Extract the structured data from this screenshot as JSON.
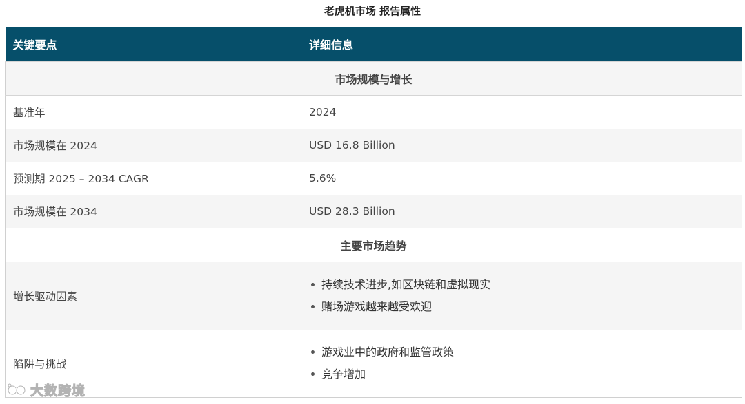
{
  "title": "老虎机市场 报告属性",
  "header": {
    "col1": "关键要点",
    "col2": "详细信息"
  },
  "sections": [
    {
      "heading": "市场规模与增长",
      "rows": [
        {
          "key": "基准年",
          "value": "2024"
        },
        {
          "key": "市场规模在 2024",
          "value": "USD 16.8 Billion"
        },
        {
          "key": "预测期 2025 – 2034 CAGR",
          "value": "5.6%"
        },
        {
          "key": "市场规模在 2034",
          "value": "USD 28.3 Billion"
        }
      ]
    },
    {
      "heading": "主要市场趋势",
      "rows": [
        {
          "key": "增长驱动因素",
          "items": [
            "持续技术进步,如区块链和虚拟现实",
            "赌场游戏越来越受欢迎"
          ]
        },
        {
          "key": "陷阱与挑战",
          "items": [
            "游戏业中的政府和监管政策",
            "竞争增加"
          ]
        }
      ]
    }
  ],
  "watermark": {
    "text": "大数跨境",
    "logo_icon": "brand-logo-icon"
  }
}
